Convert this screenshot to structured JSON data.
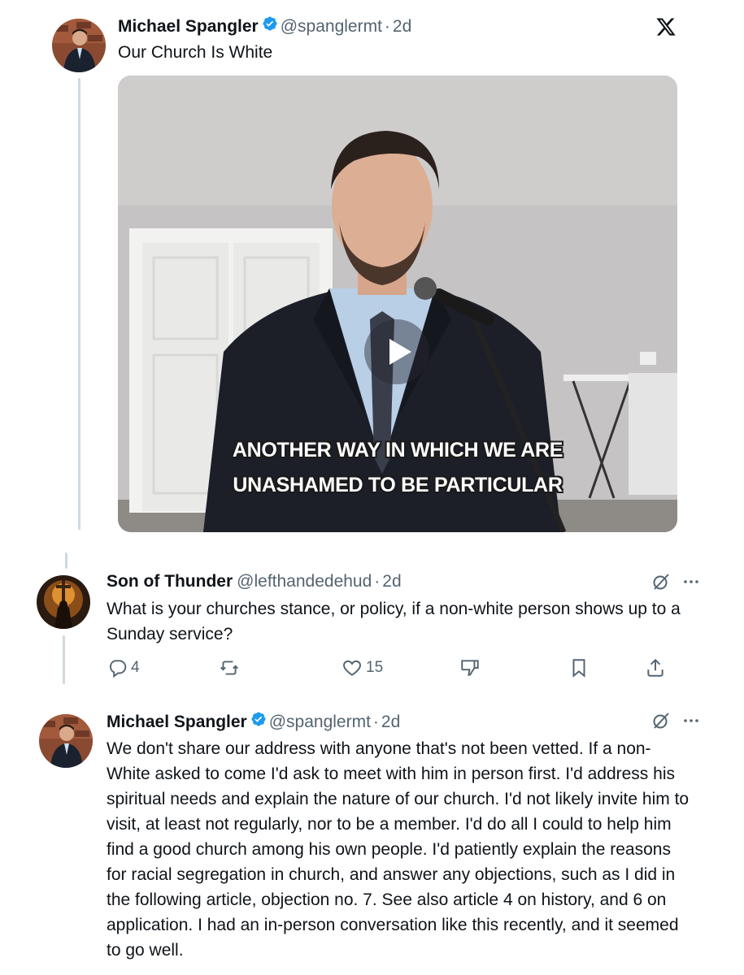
{
  "post": {
    "author_name": "Michael Spangler",
    "author_handle": "@spanglermt",
    "separator": "·",
    "time": "2d",
    "text": "Our Church Is White",
    "video_caption_line1": "ANOTHER WAY IN WHICH WE ARE",
    "video_caption_line2": "UNASHAMED TO BE PARTICULAR",
    "brand_icon": "x-logo-icon"
  },
  "reply1": {
    "author_name": "Son of Thunder",
    "author_handle": "@lefthandedehud",
    "separator": "·",
    "time": "2d",
    "text": "What is your churches stance, or policy, if a non-white person shows up to a Sunday service?",
    "reply_count": "4",
    "like_count": "15"
  },
  "reply2": {
    "author_name": "Michael Spangler",
    "author_handle": "@spanglermt",
    "separator": "·",
    "time": "2d",
    "text": "We don't share our address with anyone that's not been vetted. If a non-White asked to come I'd ask to meet with him in person first. I'd address his spiritual needs and explain the nature of our church. I'd not likely invite him to visit, at least not regularly, nor to be a member. I'd do all I could to help him find a good church among his own people. I'd patiently explain the reasons for racial segregation in church, and answer any objections, such as I did in the following article, objection no. 7. See also article 4 on history, and 6 on application. I had an in-person conversation like this recently, and it seemed to go well."
  },
  "colors": {
    "verified": "#1d9bf0",
    "secondary_text": "#536471",
    "thread_line": "#cfd9de"
  }
}
